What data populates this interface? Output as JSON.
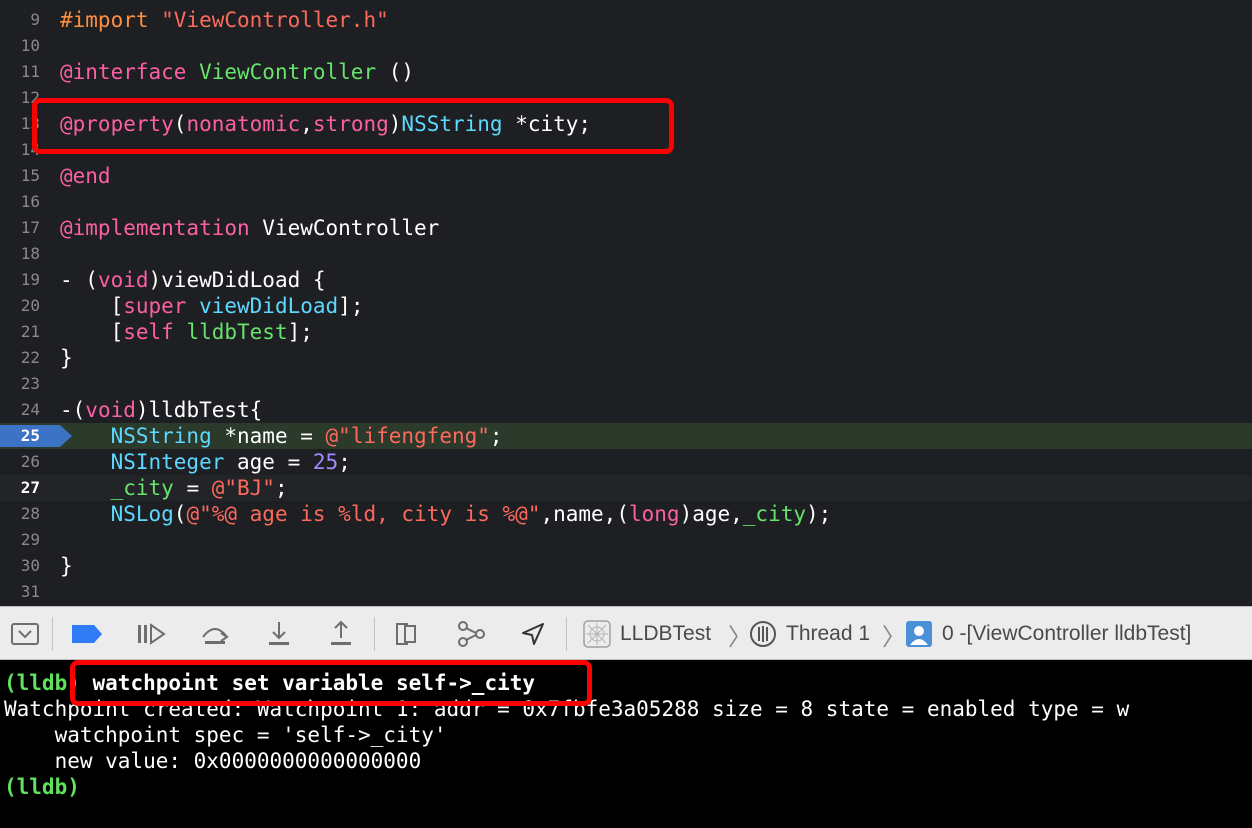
{
  "editor": {
    "lines": [
      {
        "num": "9",
        "tokens": [
          {
            "t": "#import ",
            "c": "dir"
          },
          {
            "t": "\"ViewController.h\"",
            "c": "str"
          }
        ]
      },
      {
        "num": "10",
        "tokens": []
      },
      {
        "num": "11",
        "tokens": [
          {
            "t": "@interface",
            "c": "kw"
          },
          {
            "t": " ",
            "c": "plain"
          },
          {
            "t": "ViewController",
            "c": "prj"
          },
          {
            "t": " ()",
            "c": "plain"
          }
        ]
      },
      {
        "num": "12",
        "tokens": []
      },
      {
        "num": "13",
        "tokens": [
          {
            "t": "@property",
            "c": "kw"
          },
          {
            "t": "(",
            "c": "plain"
          },
          {
            "t": "nonatomic",
            "c": "kw"
          },
          {
            "t": ",",
            "c": "plain"
          },
          {
            "t": "strong",
            "c": "kw"
          },
          {
            "t": ")",
            "c": "plain"
          },
          {
            "t": "NSString",
            "c": "cls"
          },
          {
            "t": " *city;",
            "c": "plain"
          }
        ]
      },
      {
        "num": "14",
        "tokens": []
      },
      {
        "num": "15",
        "tokens": [
          {
            "t": "@end",
            "c": "kw"
          }
        ]
      },
      {
        "num": "16",
        "tokens": []
      },
      {
        "num": "17",
        "tokens": [
          {
            "t": "@implementation",
            "c": "kw"
          },
          {
            "t": " ViewController",
            "c": "plain"
          }
        ]
      },
      {
        "num": "18",
        "tokens": []
      },
      {
        "num": "19",
        "tokens": [
          {
            "t": "- (",
            "c": "plain"
          },
          {
            "t": "void",
            "c": "kw"
          },
          {
            "t": ")viewDidLoad {",
            "c": "plain"
          }
        ]
      },
      {
        "num": "20",
        "tokens": [
          {
            "t": "    [",
            "c": "plain"
          },
          {
            "t": "super",
            "c": "kw"
          },
          {
            "t": " ",
            "c": "plain"
          },
          {
            "t": "viewDidLoad",
            "c": "cls"
          },
          {
            "t": "];",
            "c": "plain"
          }
        ]
      },
      {
        "num": "21",
        "tokens": [
          {
            "t": "    [",
            "c": "plain"
          },
          {
            "t": "self",
            "c": "kw"
          },
          {
            "t": " ",
            "c": "plain"
          },
          {
            "t": "lldbTest",
            "c": "prj"
          },
          {
            "t": "];",
            "c": "plain"
          }
        ]
      },
      {
        "num": "22",
        "tokens": [
          {
            "t": "}",
            "c": "plain"
          }
        ]
      },
      {
        "num": "23",
        "tokens": []
      },
      {
        "num": "24",
        "tokens": [
          {
            "t": "-(",
            "c": "plain"
          },
          {
            "t": "void",
            "c": "kw"
          },
          {
            "t": ")lldbTest{",
            "c": "plain"
          }
        ]
      },
      {
        "num": "25",
        "tokens": [
          {
            "t": "    ",
            "c": "plain"
          },
          {
            "t": "NSString",
            "c": "cls"
          },
          {
            "t": " *name = ",
            "c": "plain"
          },
          {
            "t": "@\"lifengfeng\"",
            "c": "str"
          },
          {
            "t": ";",
            "c": "plain"
          }
        ]
      },
      {
        "num": "26",
        "tokens": [
          {
            "t": "    ",
            "c": "plain"
          },
          {
            "t": "NSInteger",
            "c": "typ"
          },
          {
            "t": " age = ",
            "c": "plain"
          },
          {
            "t": "25",
            "c": "num"
          },
          {
            "t": ";",
            "c": "plain"
          }
        ]
      },
      {
        "num": "27",
        "tokens": [
          {
            "t": "    ",
            "c": "plain"
          },
          {
            "t": "_city",
            "c": "prj"
          },
          {
            "t": " = ",
            "c": "plain"
          },
          {
            "t": "@\"BJ\"",
            "c": "str"
          },
          {
            "t": ";",
            "c": "plain"
          }
        ]
      },
      {
        "num": "28",
        "tokens": [
          {
            "t": "    ",
            "c": "plain"
          },
          {
            "t": "NSLog",
            "c": "cls"
          },
          {
            "t": "(",
            "c": "plain"
          },
          {
            "t": "@\"%@ age is %ld, city is %@\"",
            "c": "str"
          },
          {
            "t": ",name,(",
            "c": "plain"
          },
          {
            "t": "long",
            "c": "kw"
          },
          {
            "t": ")age,",
            "c": "plain"
          },
          {
            "t": "_city",
            "c": "prj"
          },
          {
            "t": ");",
            "c": "plain"
          }
        ]
      },
      {
        "num": "29",
        "tokens": []
      },
      {
        "num": "30",
        "tokens": [
          {
            "t": "}",
            "c": "plain"
          }
        ]
      },
      {
        "num": "31",
        "tokens": []
      }
    ],
    "pc_line": "25",
    "current_line": "27"
  },
  "debugbar": {
    "buttons": [
      "hide-console-icon",
      "breakpoints-toggle-icon",
      "continue-icon",
      "step-over-icon",
      "step-into-icon",
      "step-out-icon",
      "view-debugger-icon",
      "memory-graph-icon",
      "location-icon"
    ],
    "crumbs": {
      "target": "LLDBTest",
      "thread": "Thread 1",
      "frame": "0 -[ViewController lldbTest]"
    }
  },
  "console": {
    "prompt": "(lldb)",
    "command": "watchpoint set variable self->_city",
    "output": [
      "Watchpoint created: Watchpoint 1: addr = 0x7fbfe3a05288 size = 8 state = enabled type = w",
      "    watchpoint spec = 'self->_city'",
      "    new value: 0x0000000000000000"
    ],
    "final_prompt": "(lldb)"
  },
  "colors": {
    "editor_bg": "#1e1f22",
    "keyword": "#fc5fa3",
    "string": "#fc6a5d",
    "directive": "#fd8f3f",
    "class": "#5dd8ff",
    "project": "#67e36b",
    "number": "#9d8bff",
    "prompt": "#5fe35f",
    "annotation": "#ff0000"
  }
}
